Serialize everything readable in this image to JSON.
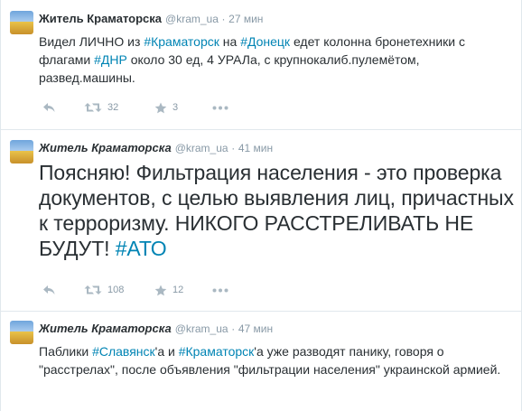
{
  "tweets": [
    {
      "fullname": "Житель Краматорска",
      "username": "@kram_ua",
      "time_sep": "·",
      "timestamp": "27 мин",
      "text_parts": [
        {
          "t": "Видел ЛИЧНО из ",
          "h": false
        },
        {
          "t": "#Краматорск",
          "h": true
        },
        {
          "t": " на ",
          "h": false
        },
        {
          "t": "#Донецк",
          "h": true
        },
        {
          "t": " едет колонна бронетехники с флагами ",
          "h": false
        },
        {
          "t": "#ДНР",
          "h": true
        },
        {
          "t": " около 30 ед, 4 УРАЛа, с крупнокалиб.пулемётом, развед.машины.",
          "h": false
        }
      ],
      "retweets": "32",
      "favorites": "3",
      "icons": [
        "reply-icon",
        "retweet-icon",
        "star-icon",
        "more-icon"
      ]
    },
    {
      "fullname": "Житель Краматорска",
      "username": "@kram_ua",
      "time_sep": "·",
      "timestamp": "41 мин",
      "text_parts": [
        {
          "t": "Поясняю! Фильтрация населения - это проверка документов, с целью выявления лиц, причастных к терроризму. НИКОГО РАССТРЕЛИВАТЬ НЕ БУДУТ! ",
          "h": false
        },
        {
          "t": "#АТО",
          "h": true
        }
      ],
      "retweets": "108",
      "favorites": "12",
      "icons": [
        "reply-icon",
        "retweet-icon",
        "star-icon",
        "more-icon"
      ]
    },
    {
      "fullname": "Житель Краматорска",
      "username": "@kram_ua",
      "time_sep": "·",
      "timestamp": "47 мин",
      "text_parts": [
        {
          "t": "Паблики ",
          "h": false
        },
        {
          "t": "#Славянск",
          "h": true
        },
        {
          "t": "'а и ",
          "h": false
        },
        {
          "t": "#Краматорск",
          "h": true
        },
        {
          "t": "'а уже разводят панику, говоря о \"расстрелах\", после объявления \"фильтрации населения\" украинской армией.",
          "h": false
        }
      ]
    }
  ],
  "colors": {
    "hashtag": "#0084b4",
    "action_icon": "#aab8c2",
    "meta": "#8899a6",
    "divider": "#e1e8ed"
  }
}
